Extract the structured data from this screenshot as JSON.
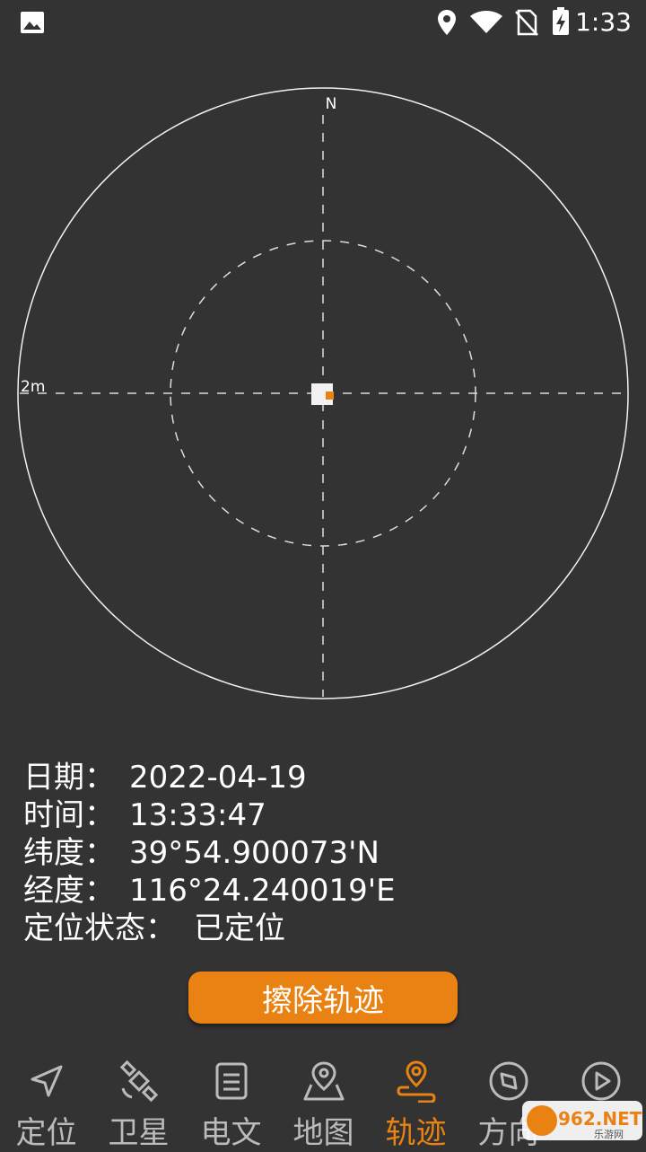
{
  "status_bar": {
    "time": "1:33",
    "icons": [
      "image-icon",
      "location-pin-icon",
      "wifi-icon",
      "no-sim-icon",
      "battery-charging-icon"
    ]
  },
  "radar": {
    "north_label": "N",
    "scale_label": "2m",
    "position_marker_color": "#ea8213"
  },
  "info": {
    "date_label": "日期：",
    "date_value": "2022-04-19",
    "time_label": "时间：",
    "time_value": "13:33:47",
    "lat_label": "纬度：",
    "lat_value": "39°54.900073'N",
    "lon_label": "经度：",
    "lon_value": "116°24.240019'E",
    "status_label": "定位状态：",
    "status_value": "已定位"
  },
  "clear_button": {
    "label": "擦除轨迹"
  },
  "tabs": [
    {
      "label": "定位",
      "icon": "navigation-arrow-icon",
      "active": false
    },
    {
      "label": "卫星",
      "icon": "satellite-icon",
      "active": false
    },
    {
      "label": "电文",
      "icon": "document-icon",
      "active": false
    },
    {
      "label": "地图",
      "icon": "map-pin-icon",
      "active": false
    },
    {
      "label": "轨迹",
      "icon": "track-pin-icon",
      "active": true
    },
    {
      "label": "方向",
      "icon": "compass-icon",
      "active": false
    },
    {
      "label": "",
      "icon": "play-icon",
      "active": false
    }
  ],
  "watermark": {
    "text": "962.NET",
    "subtext": "乐游网"
  },
  "colors": {
    "background": "#333333",
    "accent": "#ea8213",
    "inactive": "#bbbbbb"
  }
}
